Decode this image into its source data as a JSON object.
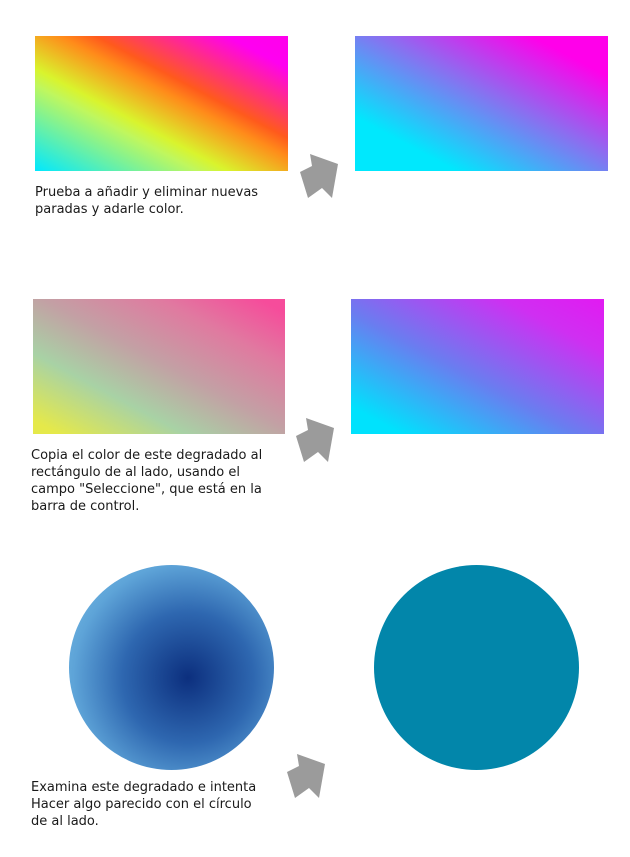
{
  "exercises": [
    {
      "instruction": "Prueba a añadir y eliminar nuevas\nparadas y adarle color."
    },
    {
      "instruction": "Copia el color de este degradado al\nrectángulo de al lado, usando el\ncampo \"Seleccione\", que está en la\nbarra de control."
    },
    {
      "instruction": "Examina este degradado e intenta\nHacer algo parecido con el círculo\nde al lado."
    }
  ],
  "colors": {
    "arrow": "#9b9b9b",
    "solid_circle": "#0286aa"
  },
  "icons": {
    "arrow": "right-arrow-icon"
  }
}
